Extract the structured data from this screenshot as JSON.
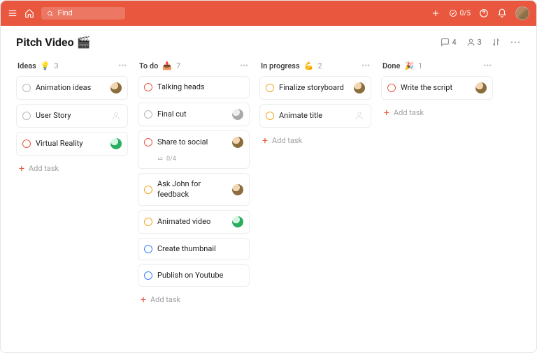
{
  "search_placeholder": "Find",
  "progress_pill": "0/5",
  "project_title": "Pitch Video 🎬",
  "header_stats": {
    "comments": 4,
    "members": 3
  },
  "add_task_label": "Add task",
  "columns": [
    {
      "name": "Ideas",
      "emoji": "💡",
      "count": 3,
      "cards": [
        {
          "title": "Animation ideas",
          "ring": "gray",
          "assignee": "photo"
        },
        {
          "title": "User Story",
          "ring": "gray",
          "assignee": "placeholder"
        },
        {
          "title": "Virtual Reality",
          "ring": "red",
          "assignee": "green"
        }
      ]
    },
    {
      "name": "To do",
      "emoji": "📥",
      "count": 7,
      "cards": [
        {
          "title": "Talking heads",
          "ring": "red",
          "assignee": ""
        },
        {
          "title": "Final cut",
          "ring": "gray",
          "assignee": "gray"
        },
        {
          "title": "Share to social",
          "ring": "red",
          "assignee": "photo",
          "subtasks": "0/4"
        },
        {
          "title": "Ask John for feedback",
          "ring": "orange",
          "assignee": "photo"
        },
        {
          "title": "Animated video",
          "ring": "orange",
          "assignee": "green"
        },
        {
          "title": "Create thumbnail",
          "ring": "blue",
          "assignee": ""
        },
        {
          "title": "Publish on Youtube",
          "ring": "blue",
          "assignee": ""
        }
      ]
    },
    {
      "name": "In progress",
      "emoji": "💪",
      "count": 2,
      "cards": [
        {
          "title": "Finalize storyboard",
          "ring": "orange",
          "assignee": "photo"
        },
        {
          "title": "Animate title",
          "ring": "orange",
          "assignee": "placeholder"
        }
      ]
    },
    {
      "name": "Done",
      "emoji": "🎉",
      "count": 1,
      "cards": [
        {
          "title": "Write the script",
          "ring": "red",
          "assignee": "photo"
        }
      ]
    }
  ]
}
